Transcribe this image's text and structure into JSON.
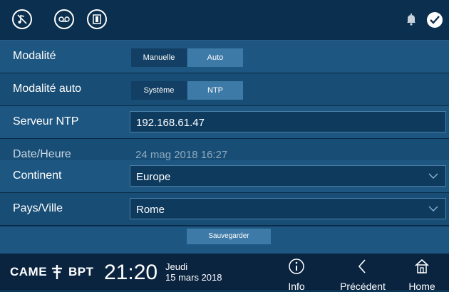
{
  "topbar": {
    "icons": [
      "music-mute-icon",
      "voicemail-icon",
      "door-icon"
    ],
    "status_icons": [
      "bell-icon",
      "check-icon"
    ]
  },
  "settings": {
    "modalite": {
      "label": "Modalité",
      "options": [
        "Manuelle",
        "Auto"
      ],
      "selected": "Auto"
    },
    "modalite_auto": {
      "label": "Modalité auto",
      "options": [
        "Système",
        "NTP"
      ],
      "selected": "NTP"
    },
    "serveur_ntp": {
      "label": "Serveur NTP",
      "value": "192.168.61.47"
    },
    "date_heure": {
      "label": "Date/Heure",
      "value": "24 mag 2018 16:27"
    },
    "continent": {
      "label": "Continent",
      "value": "Europe"
    },
    "pays_ville": {
      "label": "Pays/Ville",
      "value": "Rome"
    },
    "save_label": "Sauvegarder"
  },
  "footer": {
    "brand_came": "CAME",
    "brand_bpt": "BPT",
    "time": "21:20",
    "day": "Jeudi",
    "date": "15 mars 2018",
    "nav": [
      {
        "label": "Info",
        "icon": "info-icon"
      },
      {
        "label": "Précédent",
        "icon": "chevron-left-icon"
      },
      {
        "label": "Home",
        "icon": "home-icon"
      }
    ]
  },
  "colors": {
    "background": "#0b3554",
    "row": "#1d5680",
    "selected": "#3e7aa7"
  }
}
